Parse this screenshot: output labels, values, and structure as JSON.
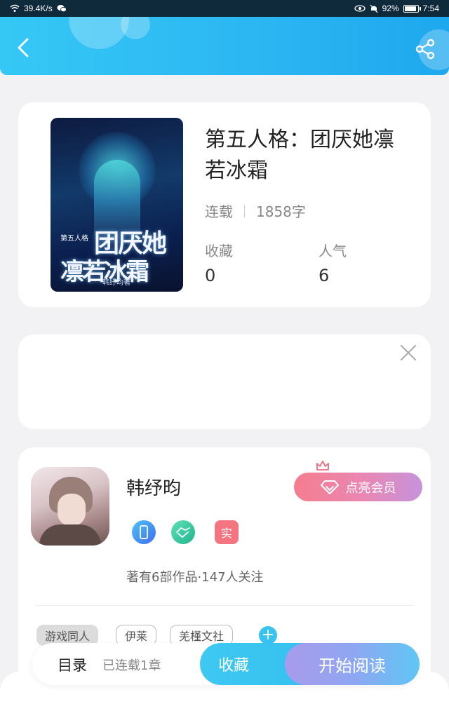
{
  "status_bar": {
    "speed": "39.4K/s",
    "battery": "92%",
    "battery_level": 0.92,
    "time": "7:54"
  },
  "header": {
    "back_icon": "chevron-left-icon",
    "share_icon": "share-icon"
  },
  "book": {
    "title": "第五人格：团厌她凛若冰霜",
    "status": "连载",
    "word_count": "1858字",
    "favorites_label": "收藏",
    "favorites_value": "0",
    "popularity_label": "人气",
    "popularity_value": "6",
    "cover": {
      "small_label": "第五人格",
      "line1": "团厌她",
      "line2": "凛若冰霜",
      "author": "韩纾昀著"
    }
  },
  "ad": {
    "close_icon": "close-icon"
  },
  "author": {
    "name": "韩纾昀",
    "vip_button": "点亮会员",
    "badge_real": "实",
    "stats": "著有6部作品·147人关注",
    "tags": [
      "游戏同人",
      "伊莱",
      "羌槿文社"
    ],
    "add_tag": "+"
  },
  "bottom_bar": {
    "toc_label": "目录",
    "toc_count": "已连载1章",
    "favorite_button": "收藏",
    "read_button": "开始阅读"
  },
  "colors": {
    "header": "#2bb5f2",
    "accent_blue": "#38c3f1",
    "vip_pink": "#f57d8e"
  }
}
